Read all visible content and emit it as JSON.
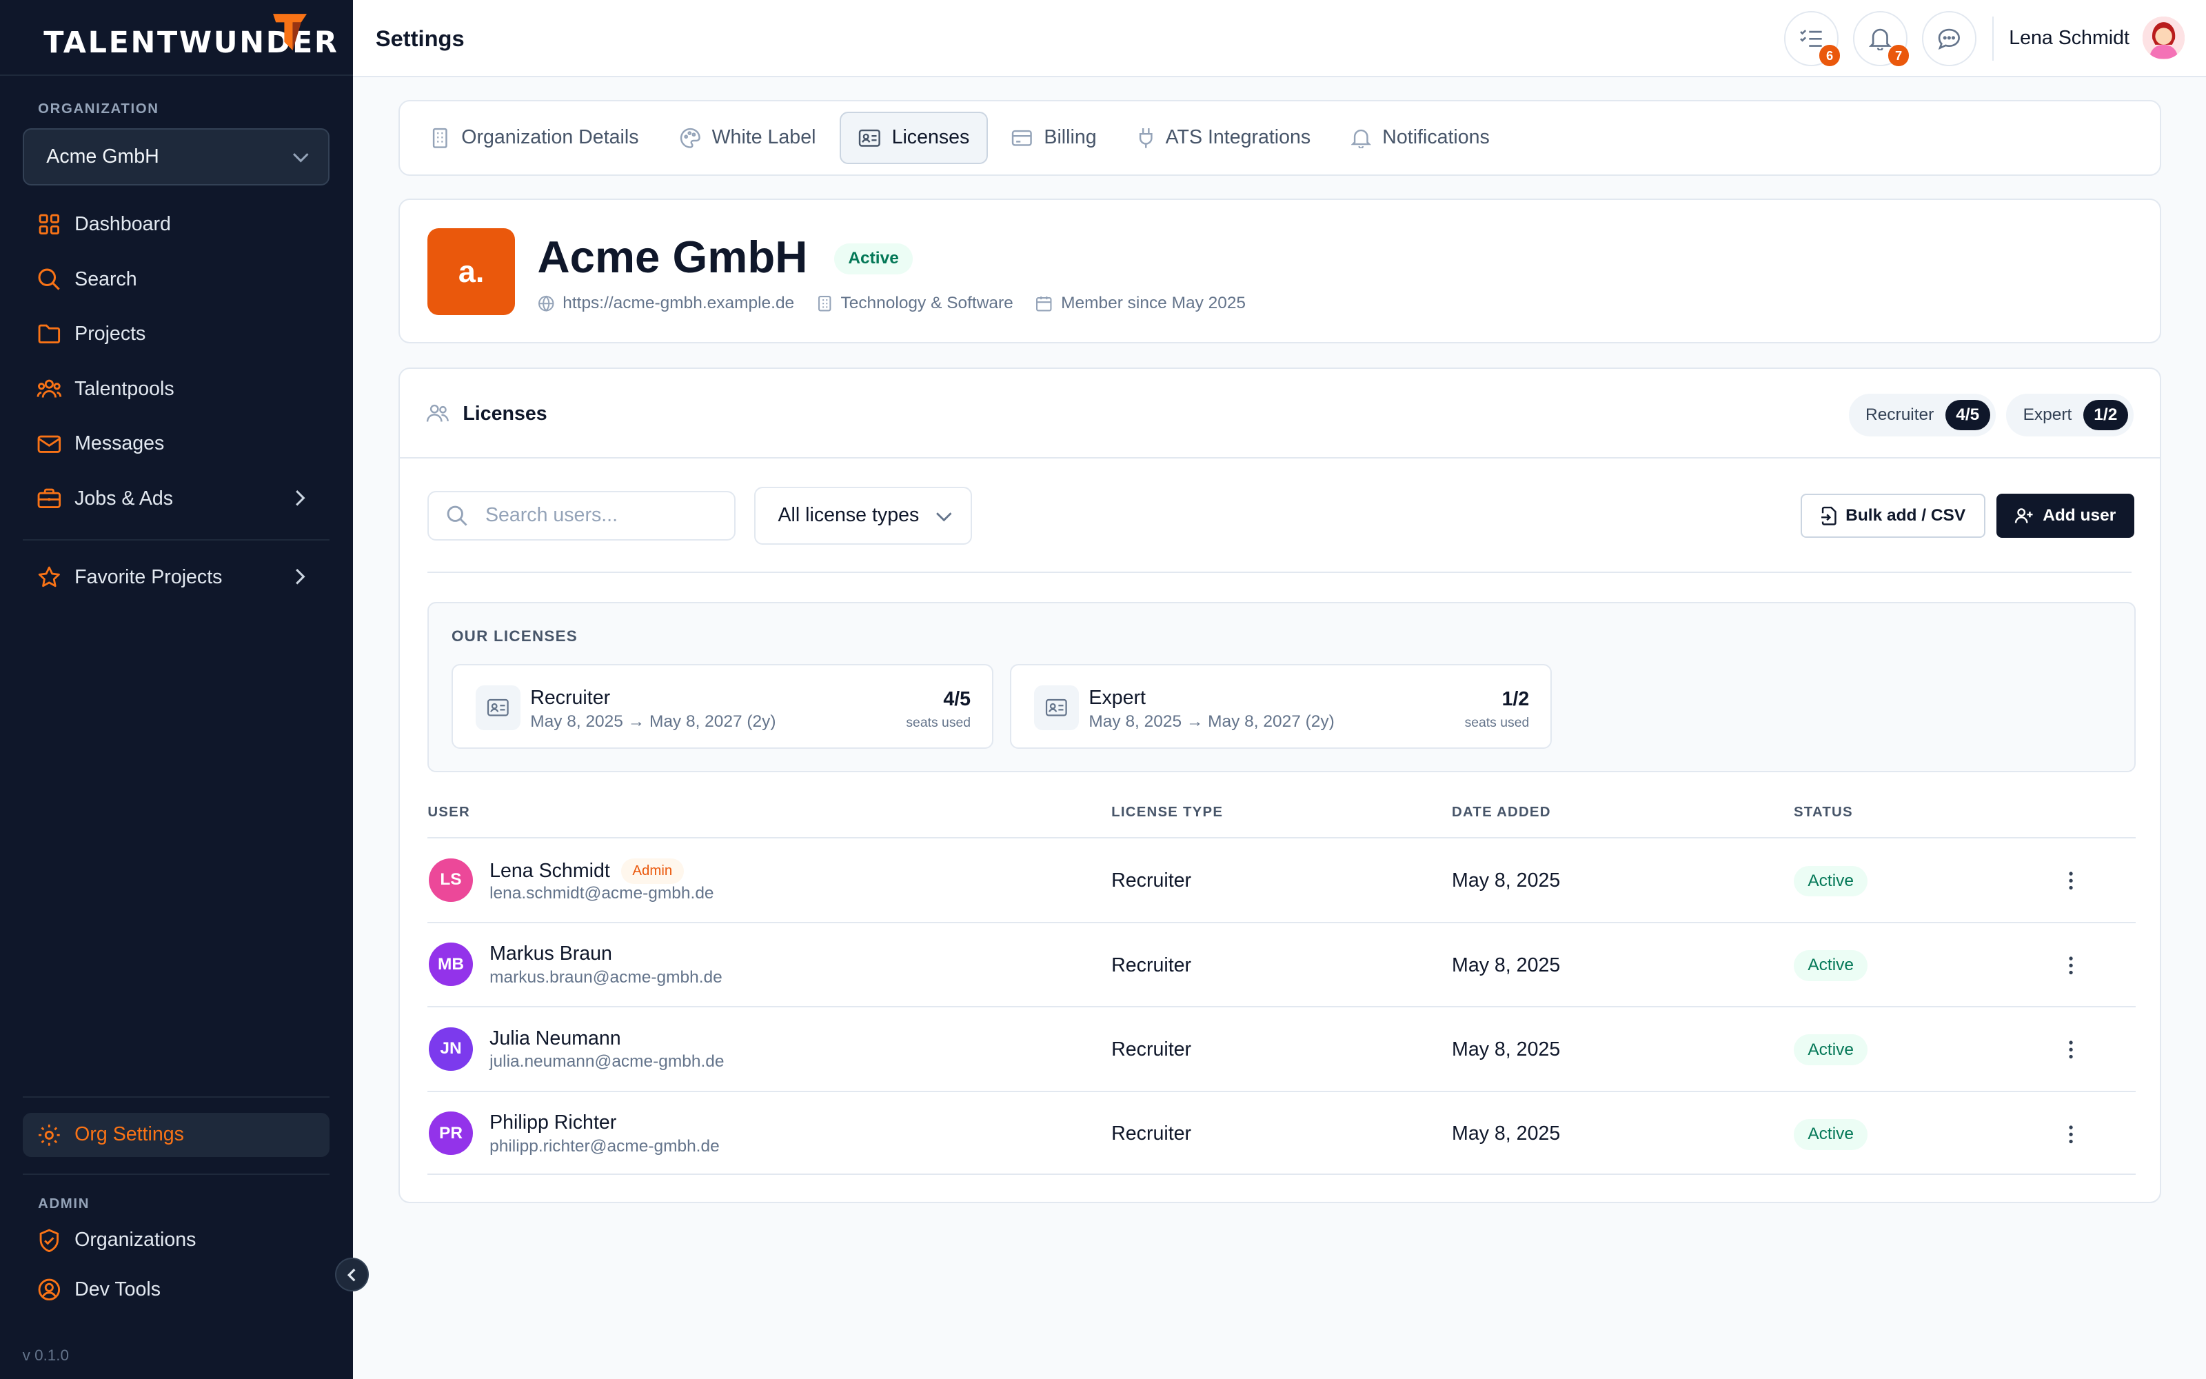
{
  "sidebar": {
    "logo_text": "TALENTWUNDER",
    "org_section_label": "ORGANIZATION",
    "org_selected": "Acme GmbH",
    "items": [
      {
        "label": "Dashboard",
        "icon": "dashboard-icon"
      },
      {
        "label": "Search",
        "icon": "search-icon"
      },
      {
        "label": "Projects",
        "icon": "folder-icon"
      },
      {
        "label": "Talentpools",
        "icon": "users-icon"
      },
      {
        "label": "Messages",
        "icon": "mail-icon"
      },
      {
        "label": "Jobs & Ads",
        "icon": "briefcase-icon"
      },
      {
        "label": "Favorite Projects",
        "icon": "star-icon"
      }
    ],
    "org_settings_label": "Org Settings",
    "admin_section_label": "ADMIN",
    "admin_items": [
      {
        "label": "Organizations",
        "icon": "shield-icon"
      },
      {
        "label": "Dev Tools",
        "icon": "user-circle-icon"
      }
    ],
    "version": "v 0.1.0"
  },
  "topbar": {
    "title": "Settings",
    "tasks_badge": "6",
    "notifications_badge": "7",
    "user_name": "Lena Schmidt"
  },
  "tabs": [
    {
      "label": "Organization Details",
      "icon": "building-icon"
    },
    {
      "label": "White Label",
      "icon": "palette-icon"
    },
    {
      "label": "Licenses",
      "icon": "id-card-icon",
      "active": true
    },
    {
      "label": "Billing",
      "icon": "credit-card-icon"
    },
    {
      "label": "ATS Integrations",
      "icon": "plug-icon"
    },
    {
      "label": "Notifications",
      "icon": "bell-icon"
    }
  ],
  "org": {
    "logo_text": "a.",
    "name": "Acme GmbH",
    "status": "Active",
    "website": "https://acme-gmbh.example.de",
    "industry": "Technology & Software",
    "member_since": "Member since May 2025"
  },
  "licenses": {
    "title": "Licenses",
    "summary": [
      {
        "label": "Recruiter",
        "count": "4/5"
      },
      {
        "label": "Expert",
        "count": "1/2"
      }
    ],
    "search_placeholder": "Search users...",
    "filter_label": "All license types",
    "bulk_add_label": "Bulk add / CSV",
    "add_user_label": "Add user",
    "our_licenses_label": "OUR LICENSES",
    "license_boxes": [
      {
        "name": "Recruiter",
        "dates": "May 8, 2025 → May 8, 2027 (2y)",
        "count": "4/5",
        "seats_label": "seats used"
      },
      {
        "name": "Expert",
        "dates": "May 8, 2025 → May 8, 2027 (2y)",
        "count": "1/2",
        "seats_label": "seats used"
      }
    ],
    "columns": {
      "user": "USER",
      "license_type": "LICENSE TYPE",
      "date_added": "DATE ADDED",
      "status": "STATUS"
    },
    "users": [
      {
        "initials": "LS",
        "name": "Lena Schmidt",
        "admin_badge": "Admin",
        "email": "lena.schmidt@acme-gmbh.de",
        "license_type": "Recruiter",
        "date_added": "May 8, 2025",
        "status": "Active",
        "avatar_color": "#ec4899"
      },
      {
        "initials": "MB",
        "name": "Markus Braun",
        "email": "markus.braun@acme-gmbh.de",
        "license_type": "Recruiter",
        "date_added": "May 8, 2025",
        "status": "Active",
        "avatar_color": "#9333ea"
      },
      {
        "initials": "JN",
        "name": "Julia Neumann",
        "email": "julia.neumann@acme-gmbh.de",
        "license_type": "Recruiter",
        "date_added": "May 8, 2025",
        "status": "Active",
        "avatar_color": "#7c3aed"
      },
      {
        "initials": "PR",
        "name": "Philipp Richter",
        "email": "philipp.richter@acme-gmbh.de",
        "license_type": "Recruiter",
        "date_added": "May 8, 2025",
        "status": "Active",
        "avatar_color": "#9333ea"
      }
    ]
  },
  "colors": {
    "accent": "#ea580c",
    "sidebar_bg": "#0f172a",
    "active_green": "#047857"
  }
}
